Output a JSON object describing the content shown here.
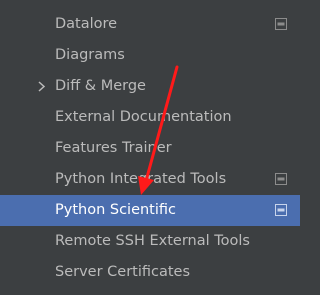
{
  "settings_tree": {
    "items": [
      {
        "label": "Datalore",
        "expandable": false,
        "project_icon": true,
        "selected": false
      },
      {
        "label": "Diagrams",
        "expandable": false,
        "project_icon": false,
        "selected": false
      },
      {
        "label": "Diff & Merge",
        "expandable": true,
        "project_icon": false,
        "selected": false
      },
      {
        "label": "External Documentation",
        "expandable": false,
        "project_icon": false,
        "selected": false
      },
      {
        "label": "Features Trainer",
        "expandable": false,
        "project_icon": false,
        "selected": false
      },
      {
        "label": "Python Integrated Tools",
        "expandable": false,
        "project_icon": true,
        "selected": false
      },
      {
        "label": "Python Scientific",
        "expandable": false,
        "project_icon": true,
        "selected": true
      },
      {
        "label": "Remote SSH External Tools",
        "expandable": false,
        "project_icon": false,
        "selected": false
      },
      {
        "label": "Server Certificates",
        "expandable": false,
        "project_icon": false,
        "selected": false
      }
    ]
  },
  "icons": {
    "expand": "chevron-right-icon",
    "project_scope": "project-settings-icon"
  },
  "colors": {
    "background": "#3c3f41",
    "selection": "#4b6eaf",
    "text": "#bbbbbb",
    "selected_text": "#ffffff",
    "annotation_arrow": "#ff0000"
  }
}
